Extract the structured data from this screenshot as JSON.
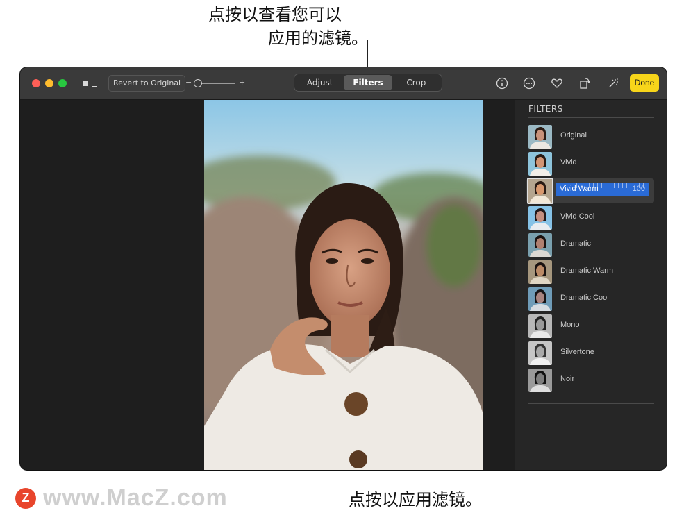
{
  "callouts": {
    "top_line1": "点按以查看您可以",
    "top_line2": "应用的滤镜。",
    "bottom": "点按以应用滤镜。"
  },
  "watermark": {
    "logo_letter": "Z",
    "text": "www.MacZ.com"
  },
  "toolbar": {
    "revert_label": "Revert to Original",
    "slider_minus": "−",
    "slider_plus": "+",
    "tabs": [
      {
        "label": "Adjust",
        "active": false
      },
      {
        "label": "Filters",
        "active": true
      },
      {
        "label": "Crop",
        "active": false
      }
    ],
    "icons": [
      "info-icon",
      "more-icon",
      "heart-icon",
      "rotate-icon",
      "magic-wand-icon"
    ],
    "done_label": "Done",
    "accent": "#f7d51a"
  },
  "sidebar": {
    "title": "FILTERS",
    "filters": [
      {
        "label": "Original"
      },
      {
        "label": "Vivid"
      },
      {
        "label": "Vivid Warm",
        "selected": true,
        "intensity": "100"
      },
      {
        "label": "Vivid Cool"
      },
      {
        "label": "Dramatic"
      },
      {
        "label": "Dramatic Warm"
      },
      {
        "label": "Dramatic Cool"
      },
      {
        "label": "Mono"
      },
      {
        "label": "Silvertone"
      },
      {
        "label": "Noir"
      }
    ],
    "selection_color": "#2a6bd6"
  }
}
